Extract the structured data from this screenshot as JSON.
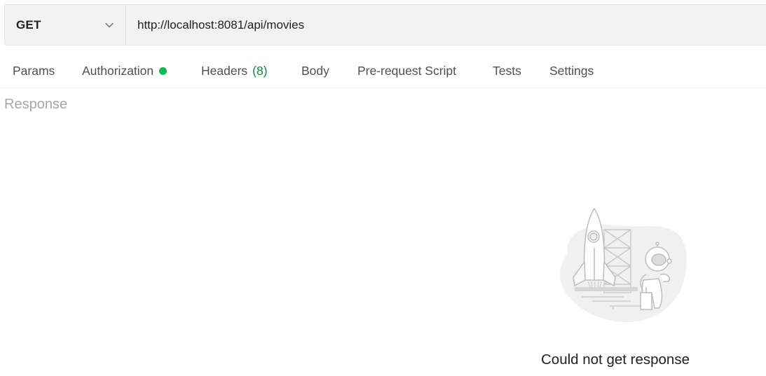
{
  "request": {
    "method": "GET",
    "url": "http://localhost:8081/api/movies"
  },
  "tabs": [
    {
      "label": "Params"
    },
    {
      "label": "Authorization",
      "indicator": "green-dot"
    },
    {
      "label": "Headers",
      "count": "(8)"
    },
    {
      "label": "Body"
    },
    {
      "label": "Pre-request Script"
    },
    {
      "label": "Tests"
    },
    {
      "label": "Settings"
    }
  ],
  "response": {
    "label": "Response",
    "empty_message": "Could not get response",
    "illustration": "rocket-astronaut-illustration"
  },
  "colors": {
    "accent_green": "#0cbb52",
    "count_green": "#0f8a43",
    "muted_text": "#a6a6a6"
  }
}
